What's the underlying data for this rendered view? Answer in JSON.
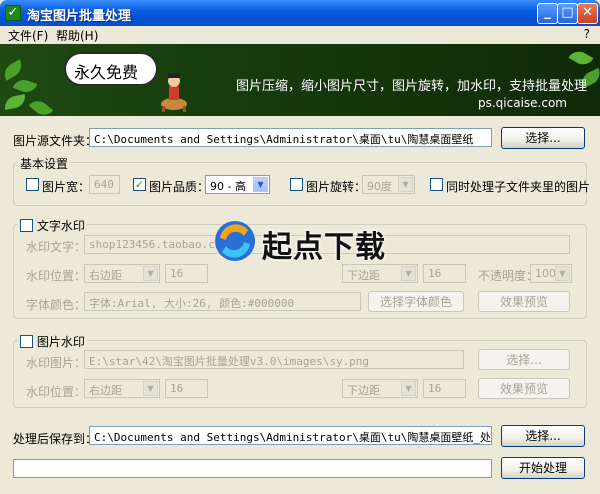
{
  "window": {
    "title": "淘宝图片批量处理"
  },
  "menu": {
    "file": "文件(F)",
    "help": "帮助(H)",
    "help_q": "?"
  },
  "banner": {
    "bubble": "永久免费",
    "tagline": "图片压缩，缩小图片尺寸，图片旋转，加水印，支持批量处理",
    "url": "ps.qicaise.com"
  },
  "source": {
    "label": "图片源文件夹：",
    "path": "C:\\Documents and Settings\\Administrator\\桌面\\tu\\陶慧桌面壁纸",
    "button": "选择..."
  },
  "basic": {
    "legend": "基本设置",
    "width_label": "图片宽：",
    "width_value": "640",
    "quality_label": "图片品质：",
    "quality_value": "90 - 高",
    "rotate_label": "图片旋转：",
    "rotate_value": "90度",
    "subfolder_label": "同时处理子文件夹里的图片"
  },
  "text_wm": {
    "legend": "文字水印",
    "text_label": "水印文字：",
    "text_value": "shop123456.taobao.com",
    "pos_label": "水印位置：",
    "h_pos": "右边距",
    "h_val": "16",
    "v_pos": "下边距",
    "v_val": "16",
    "opacity_label": "不透明度：",
    "opacity_value": "100%",
    "font_label": "字体颜色：",
    "font_value": "字体:Arial, 大小:26, 颜色:#000000",
    "font_button": "选择字体颜色",
    "preview_button": "效果预览"
  },
  "img_wm": {
    "legend": "图片水印",
    "img_label": "水印图片：",
    "img_value": "E:\\star\\42\\淘宝图片批量处理v3.0\\images\\sy.png",
    "img_button": "选择...",
    "pos_label": "水印位置：",
    "h_pos": "右边距",
    "h_val": "16",
    "v_pos": "下边距",
    "v_val": "16",
    "preview_button": "效果预览"
  },
  "output": {
    "label": "处理后保存到：",
    "path": "C:\\Documents and Settings\\Administrator\\桌面\\tu\\陶慧桌面壁纸_处理后",
    "button": "选择..."
  },
  "action": {
    "start_button": "开始处理"
  },
  "overlay": {
    "watermark": "起点下载"
  }
}
